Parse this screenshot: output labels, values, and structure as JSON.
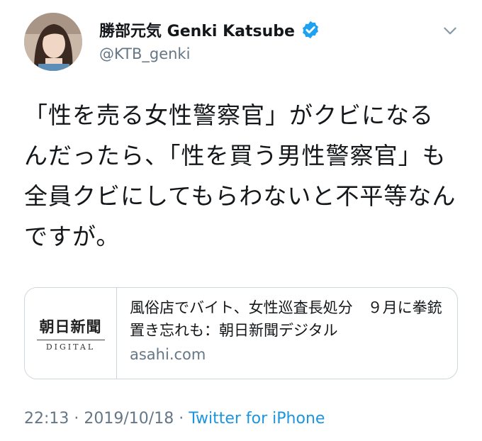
{
  "user": {
    "display_name": "勝部元気 Genki Katsube",
    "handle": "@KTB_genki",
    "verified": true
  },
  "tweet": {
    "text": "「性を売る女性警察官」がクビになるんだったら、「性を買う男性警察官」も全員クビにしてもらわないと不平等なんですが。"
  },
  "card": {
    "logo_ja": "朝日新聞",
    "logo_en": "DIGITAL",
    "title": "風俗店でバイト、女性巡査長処分　９月に拳銃置き忘れも：朝日新聞デジタル",
    "domain": "asahi.com"
  },
  "meta": {
    "time": "22:13",
    "separator": " · ",
    "date": "2019/10/18",
    "separator2": " · ",
    "source": "Twitter for iPhone"
  },
  "icons": {
    "verified": "verified-badge-icon",
    "menu": "chevron-down-icon"
  },
  "colors": {
    "accent": "#1da1f2",
    "link": "#1b95e0",
    "secondary_text": "#657786",
    "primary_text": "#14171a",
    "border": "#ccd6dd"
  }
}
